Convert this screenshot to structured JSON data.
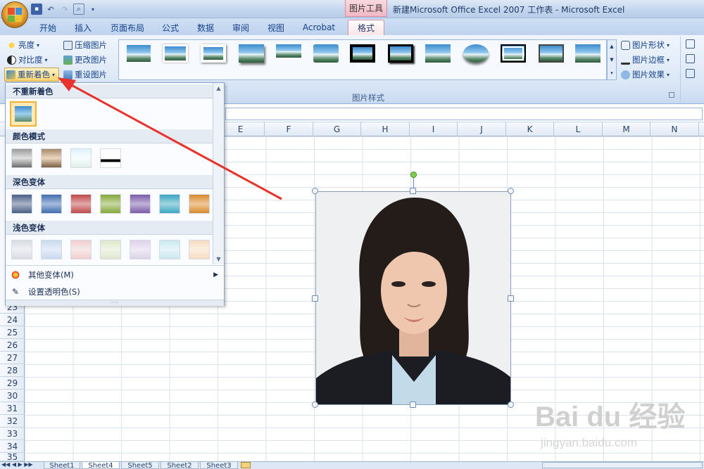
{
  "window": {
    "title": "新建Microsoft Office Excel 2007 工作表 - Microsoft Excel",
    "context_tab_title": "图片工具"
  },
  "tabs": [
    {
      "label": "开始"
    },
    {
      "label": "插入"
    },
    {
      "label": "页面布局"
    },
    {
      "label": "公式"
    },
    {
      "label": "数据"
    },
    {
      "label": "审阅"
    },
    {
      "label": "视图"
    },
    {
      "label": "Acrobat"
    },
    {
      "label": "格式"
    }
  ],
  "ribbon": {
    "adjust": {
      "brightness": "亮度",
      "contrast": "对比度",
      "recolor": "重新着色",
      "compress": "压缩图片",
      "change": "更改图片",
      "reset": "重设图片"
    },
    "styles_group_label": "图片样式",
    "right": {
      "shape": "图片形状",
      "border": "图片边框",
      "effects": "图片效果"
    }
  },
  "recolor_menu": {
    "no_recolor": "不重新着色",
    "color_modes": "颜色模式",
    "dark_variations": "深色变体",
    "light_variations": "浅色变体",
    "more_variations": "其他变体(M)",
    "set_transparent": "设置透明色(S)",
    "color_mode_swatches": [
      "grayscale",
      "sepia",
      "washout",
      "black-and-white"
    ],
    "dark_colors": [
      "#4a5f86",
      "#3f6db0",
      "#c04848",
      "#86a83a",
      "#7a5ba8",
      "#39a6c2",
      "#d98a2b"
    ],
    "light_colors": [
      "#d9dde4",
      "#c9d9ee",
      "#f0cfcf",
      "#dfe8cc",
      "#ddd3ea",
      "#cbe8f0",
      "#f6dcc0"
    ]
  },
  "sheet": {
    "columns": [
      "E",
      "F",
      "G",
      "H",
      "I",
      "J",
      "K",
      "L",
      "M",
      "N"
    ],
    "rows": [
      "23",
      "24",
      "25",
      "26",
      "27",
      "28",
      "29",
      "30",
      "31",
      "32",
      "33",
      "34",
      "35"
    ],
    "tabs": [
      "Sheet1",
      "Sheet4",
      "Sheet5",
      "Sheet2",
      "Sheet3"
    ],
    "active_tab": "Sheet4"
  },
  "watermark": {
    "text": "Bai du 经验",
    "sub": "jingyan.baidu.com"
  },
  "colors": {
    "accent_tab": "#f1b8c4",
    "arrow": "#e8322c"
  }
}
